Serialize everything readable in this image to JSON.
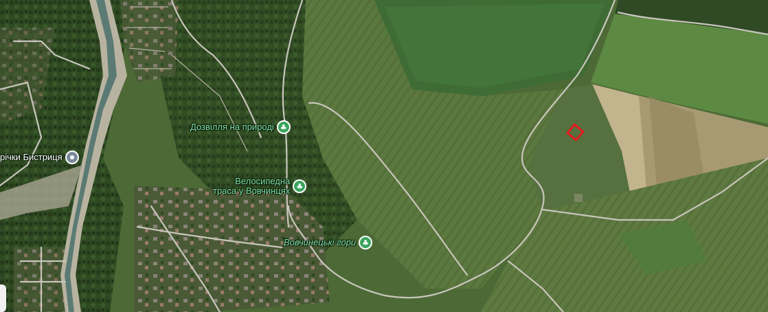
{
  "map": {
    "view": "satellite",
    "pois": [
      {
        "label": "Дозвілля на природі",
        "icon": "tree-icon",
        "color": "#3aa55d"
      },
      {
        "label_line1": "Велосипедна",
        "label_line2": "траса у Вовчинцях",
        "icon": "tree-icon",
        "color": "#3aa55d"
      },
      {
        "label": "Вовчинецькі гори",
        "icon": "tree-icon",
        "color": "#3aa55d"
      },
      {
        "label": "річки Бистриця",
        "icon": "location-icon",
        "color": "#7a8a9a"
      }
    ],
    "marker": {
      "icon": "parcel-outline-icon",
      "color": "#e21c1c"
    }
  }
}
